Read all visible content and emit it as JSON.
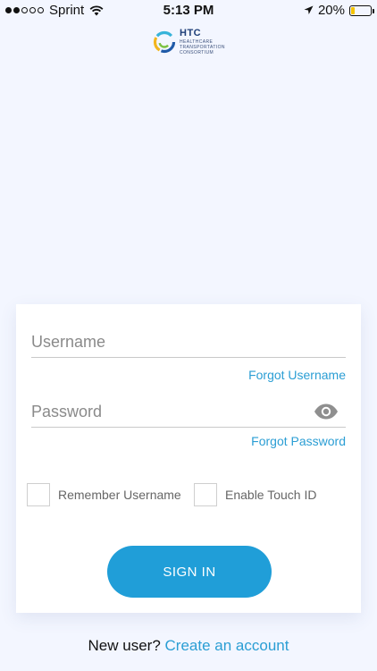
{
  "status_bar": {
    "carrier": "Sprint",
    "time": "5:13 PM",
    "battery_text": "20%",
    "battery_level": 0.2,
    "signal_bars_filled": 2,
    "signal_bars_total": 5,
    "icons": [
      "wifi-icon",
      "location-arrow-icon",
      "battery-icon"
    ]
  },
  "logo": {
    "abbr": "HTC",
    "subtitle": "Healthcare Transportation Consortium",
    "icon": "htc-logo-icon"
  },
  "login": {
    "username_placeholder": "Username",
    "password_placeholder": "Password",
    "forgot_username": "Forgot Username",
    "forgot_password": "Forgot Password",
    "remember_username": "Remember Username",
    "enable_touch_id": "Enable Touch ID",
    "sign_in": "SIGN IN",
    "show_password_icon": "eye-icon"
  },
  "footer": {
    "new_user": "New user?",
    "create_account": "Create an account"
  },
  "colors": {
    "accent": "#209ed8",
    "link": "#2b9ed4",
    "background": "#f3f6ff",
    "battery": "#f5c400"
  }
}
